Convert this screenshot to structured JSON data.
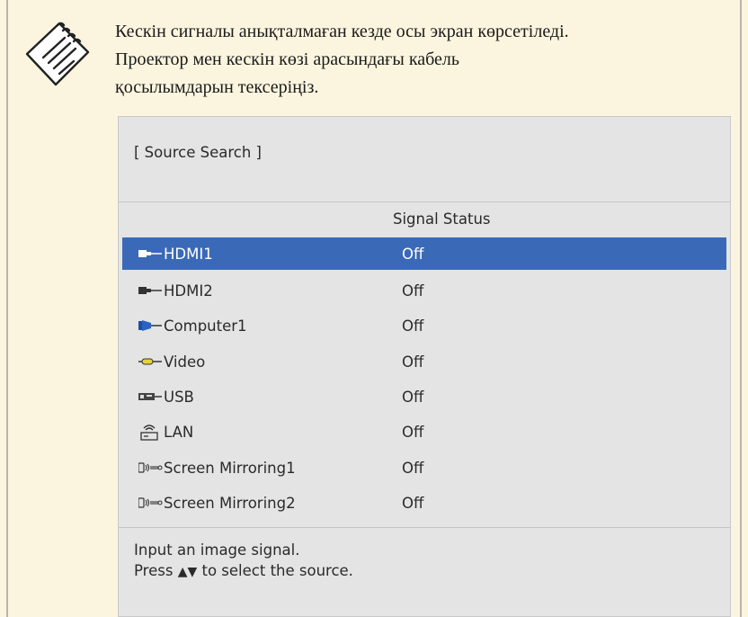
{
  "note": {
    "lines": [
      "Кескін сигналы анықталмаған кезде осы экран көрсетіледі.",
      "Проектор мен кескін көзі арасындағы кабель",
      "қосылымдарын тексеріңіз."
    ]
  },
  "osd": {
    "title": "[ Source Search ]",
    "column_header": "Signal Status",
    "sources": [
      {
        "name": "HDMI1",
        "status": "Off",
        "icon": "hdmi-icon",
        "selected": true
      },
      {
        "name": "HDMI2",
        "status": "Off",
        "icon": "hdmi-icon",
        "selected": false
      },
      {
        "name": "Computer1",
        "status": "Off",
        "icon": "vga-computer-icon",
        "selected": false
      },
      {
        "name": "Video",
        "status": "Off",
        "icon": "rca-video-icon",
        "selected": false
      },
      {
        "name": "USB",
        "status": "Off",
        "icon": "usb-icon",
        "selected": false
      },
      {
        "name": "LAN",
        "status": "Off",
        "icon": "lan-wireless-icon",
        "selected": false
      },
      {
        "name": "Screen Mirroring1",
        "status": "Off",
        "icon": "screen-mirroring-icon",
        "selected": false
      },
      {
        "name": "Screen Mirroring2",
        "status": "Off",
        "icon": "screen-mirroring-icon",
        "selected": false
      }
    ],
    "footer_line1": "Input an image signal.",
    "footer_line2_pre": "Press",
    "footer_arrows": "▲▼",
    "footer_line2_post": "to select the source."
  },
  "colors": {
    "page_background": "#fbf5df",
    "panel_background": "#e4e4e4",
    "selected_row": "#3a69b8"
  }
}
